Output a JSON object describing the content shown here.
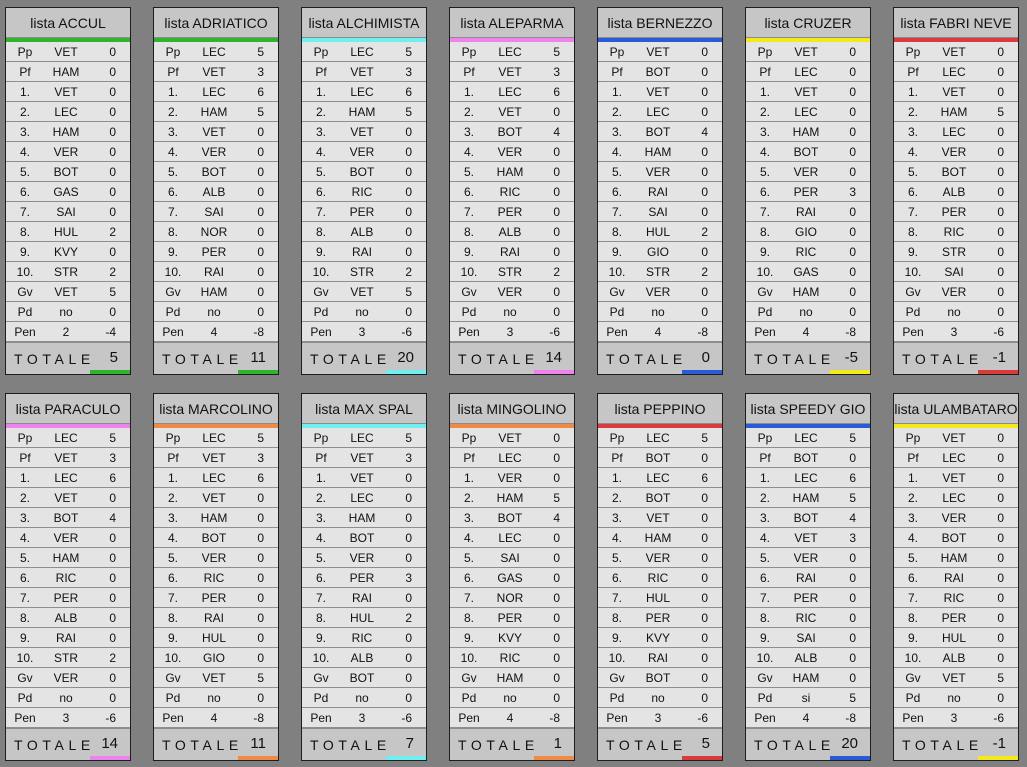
{
  "totale_label": "TOTALE",
  "cards": [
    {
      "title": "lista ACCUL",
      "color": "#2db52d",
      "total": "5",
      "rows": [
        [
          "Pp",
          "VET",
          "0"
        ],
        [
          "Pf",
          "HAM",
          "0"
        ],
        [
          "1.",
          "VET",
          "0"
        ],
        [
          "2.",
          "LEC",
          "0"
        ],
        [
          "3.",
          "HAM",
          "0"
        ],
        [
          "4.",
          "VER",
          "0"
        ],
        [
          "5.",
          "BOT",
          "0"
        ],
        [
          "6.",
          "GAS",
          "0"
        ],
        [
          "7.",
          "SAI",
          "0"
        ],
        [
          "8.",
          "HUL",
          "2"
        ],
        [
          "9.",
          "KVY",
          "0"
        ],
        [
          "10.",
          "STR",
          "2"
        ],
        [
          "Gv",
          "VET",
          "5"
        ],
        [
          "Pd",
          "no",
          "0"
        ],
        [
          "Pen",
          "2",
          "-4"
        ]
      ]
    },
    {
      "title": "lista ADRIATICO",
      "color": "#2db52d",
      "total": "11",
      "rows": [
        [
          "Pp",
          "LEC",
          "5"
        ],
        [
          "Pf",
          "VET",
          "3"
        ],
        [
          "1.",
          "LEC",
          "6"
        ],
        [
          "2.",
          "HAM",
          "5"
        ],
        [
          "3.",
          "VET",
          "0"
        ],
        [
          "4.",
          "VER",
          "0"
        ],
        [
          "5.",
          "BOT",
          "0"
        ],
        [
          "6.",
          "ALB",
          "0"
        ],
        [
          "7.",
          "SAI",
          "0"
        ],
        [
          "8.",
          "NOR",
          "0"
        ],
        [
          "9.",
          "PER",
          "0"
        ],
        [
          "10.",
          "RAI",
          "0"
        ],
        [
          "Gv",
          "HAM",
          "0"
        ],
        [
          "Pd",
          "no",
          "0"
        ],
        [
          "Pen",
          "4",
          "-8"
        ]
      ]
    },
    {
      "title": "lista ALCHIMISTA",
      "color": "#6ff0f0",
      "total": "20",
      "rows": [
        [
          "Pp",
          "LEC",
          "5"
        ],
        [
          "Pf",
          "VET",
          "3"
        ],
        [
          "1.",
          "LEC",
          "6"
        ],
        [
          "2.",
          "HAM",
          "5"
        ],
        [
          "3.",
          "VET",
          "0"
        ],
        [
          "4.",
          "VER",
          "0"
        ],
        [
          "5.",
          "BOT",
          "0"
        ],
        [
          "6.",
          "RIC",
          "0"
        ],
        [
          "7.",
          "PER",
          "0"
        ],
        [
          "8.",
          "ALB",
          "0"
        ],
        [
          "9.",
          "RAI",
          "0"
        ],
        [
          "10.",
          "STR",
          "2"
        ],
        [
          "Gv",
          "VET",
          "5"
        ],
        [
          "Pd",
          "no",
          "0"
        ],
        [
          "Pen",
          "3",
          "-6"
        ]
      ]
    },
    {
      "title": "lista ALEPARMA",
      "color": "#ee82ee",
      "total": "14",
      "rows": [
        [
          "Pp",
          "LEC",
          "5"
        ],
        [
          "Pf",
          "VET",
          "3"
        ],
        [
          "1.",
          "LEC",
          "6"
        ],
        [
          "2.",
          "VET",
          "0"
        ],
        [
          "3.",
          "BOT",
          "4"
        ],
        [
          "4.",
          "VER",
          "0"
        ],
        [
          "5.",
          "HAM",
          "0"
        ],
        [
          "6.",
          "RIC",
          "0"
        ],
        [
          "7.",
          "PER",
          "0"
        ],
        [
          "8.",
          "ALB",
          "0"
        ],
        [
          "9.",
          "RAI",
          "0"
        ],
        [
          "10.",
          "STR",
          "2"
        ],
        [
          "Gv",
          "VER",
          "0"
        ],
        [
          "Pd",
          "no",
          "0"
        ],
        [
          "Pen",
          "3",
          "-6"
        ]
      ]
    },
    {
      "title": "lista BERNEZZO",
      "color": "#2a5bd7",
      "total": "0",
      "rows": [
        [
          "Pp",
          "VET",
          "0"
        ],
        [
          "Pf",
          "BOT",
          "0"
        ],
        [
          "1.",
          "VET",
          "0"
        ],
        [
          "2.",
          "LEC",
          "0"
        ],
        [
          "3.",
          "BOT",
          "4"
        ],
        [
          "4.",
          "HAM",
          "0"
        ],
        [
          "5.",
          "VER",
          "0"
        ],
        [
          "6.",
          "RAI",
          "0"
        ],
        [
          "7.",
          "SAI",
          "0"
        ],
        [
          "8.",
          "HUL",
          "2"
        ],
        [
          "9.",
          "GIO",
          "0"
        ],
        [
          "10.",
          "STR",
          "2"
        ],
        [
          "Gv",
          "VER",
          "0"
        ],
        [
          "Pd",
          "no",
          "0"
        ],
        [
          "Pen",
          "4",
          "-8"
        ]
      ]
    },
    {
      "title": "lista CRUZER",
      "color": "#f2ea1a",
      "total": "-5",
      "rows": [
        [
          "Pp",
          "VET",
          "0"
        ],
        [
          "Pf",
          "LEC",
          "0"
        ],
        [
          "1.",
          "VET",
          "0"
        ],
        [
          "2.",
          "LEC",
          "0"
        ],
        [
          "3.",
          "HAM",
          "0"
        ],
        [
          "4.",
          "BOT",
          "0"
        ],
        [
          "5.",
          "VER",
          "0"
        ],
        [
          "6.",
          "PER",
          "3"
        ],
        [
          "7.",
          "RAI",
          "0"
        ],
        [
          "8.",
          "GIO",
          "0"
        ],
        [
          "9.",
          "RIC",
          "0"
        ],
        [
          "10.",
          "GAS",
          "0"
        ],
        [
          "Gv",
          "HAM",
          "0"
        ],
        [
          "Pd",
          "no",
          "0"
        ],
        [
          "Pen",
          "4",
          "-8"
        ]
      ]
    },
    {
      "title": "lista FABRI NEVE",
      "color": "#d93a3a",
      "total": "-1",
      "rows": [
        [
          "Pp",
          "VET",
          "0"
        ],
        [
          "Pf",
          "LEC",
          "0"
        ],
        [
          "1.",
          "VET",
          "0"
        ],
        [
          "2.",
          "HAM",
          "5"
        ],
        [
          "3.",
          "LEC",
          "0"
        ],
        [
          "4.",
          "VER",
          "0"
        ],
        [
          "5.",
          "BOT",
          "0"
        ],
        [
          "6.",
          "ALB",
          "0"
        ],
        [
          "7.",
          "PER",
          "0"
        ],
        [
          "8.",
          "RIC",
          "0"
        ],
        [
          "9.",
          "STR",
          "0"
        ],
        [
          "10.",
          "SAI",
          "0"
        ],
        [
          "Gv",
          "VER",
          "0"
        ],
        [
          "Pd",
          "no",
          "0"
        ],
        [
          "Pen",
          "3",
          "-6"
        ]
      ]
    },
    {
      "title": "lista PARACULO",
      "color": "#ee82ee",
      "total": "14",
      "rows": [
        [
          "Pp",
          "LEC",
          "5"
        ],
        [
          "Pf",
          "VET",
          "3"
        ],
        [
          "1.",
          "LEC",
          "6"
        ],
        [
          "2.",
          "VET",
          "0"
        ],
        [
          "3.",
          "BOT",
          "4"
        ],
        [
          "4.",
          "VER",
          "0"
        ],
        [
          "5.",
          "HAM",
          "0"
        ],
        [
          "6.",
          "RIC",
          "0"
        ],
        [
          "7.",
          "PER",
          "0"
        ],
        [
          "8.",
          "ALB",
          "0"
        ],
        [
          "9.",
          "RAI",
          "0"
        ],
        [
          "10.",
          "STR",
          "2"
        ],
        [
          "Gv",
          "VER",
          "0"
        ],
        [
          "Pd",
          "no",
          "0"
        ],
        [
          "Pen",
          "3",
          "-6"
        ]
      ]
    },
    {
      "title": "lista MARCOLINO",
      "color": "#f08a45",
      "total": "11",
      "rows": [
        [
          "Pp",
          "LEC",
          "5"
        ],
        [
          "Pf",
          "VET",
          "3"
        ],
        [
          "1.",
          "LEC",
          "6"
        ],
        [
          "2.",
          "VET",
          "0"
        ],
        [
          "3.",
          "HAM",
          "0"
        ],
        [
          "4.",
          "BOT",
          "0"
        ],
        [
          "5.",
          "VER",
          "0"
        ],
        [
          "6.",
          "RIC",
          "0"
        ],
        [
          "7.",
          "PER",
          "0"
        ],
        [
          "8.",
          "RAI",
          "0"
        ],
        [
          "9.",
          "HUL",
          "0"
        ],
        [
          "10.",
          "GIO",
          "0"
        ],
        [
          "Gv",
          "VET",
          "5"
        ],
        [
          "Pd",
          "no",
          "0"
        ],
        [
          "Pen",
          "4",
          "-8"
        ]
      ]
    },
    {
      "title": "lista MAX SPAL",
      "color": "#6ff0f0",
      "total": "7",
      "rows": [
        [
          "Pp",
          "LEC",
          "5"
        ],
        [
          "Pf",
          "VET",
          "3"
        ],
        [
          "1.",
          "VET",
          "0"
        ],
        [
          "2.",
          "LEC",
          "0"
        ],
        [
          "3.",
          "HAM",
          "0"
        ],
        [
          "4.",
          "BOT",
          "0"
        ],
        [
          "5.",
          "VER",
          "0"
        ],
        [
          "6.",
          "PER",
          "3"
        ],
        [
          "7.",
          "RAI",
          "0"
        ],
        [
          "8.",
          "HUL",
          "2"
        ],
        [
          "9.",
          "RIC",
          "0"
        ],
        [
          "10.",
          "ALB",
          "0"
        ],
        [
          "Gv",
          "BOT",
          "0"
        ],
        [
          "Pd",
          "no",
          "0"
        ],
        [
          "Pen",
          "3",
          "-6"
        ]
      ]
    },
    {
      "title": "lista MINGOLINO",
      "color": "#f08a45",
      "total": "1",
      "rows": [
        [
          "Pp",
          "VET",
          "0"
        ],
        [
          "Pf",
          "LEC",
          "0"
        ],
        [
          "1.",
          "VER",
          "0"
        ],
        [
          "2.",
          "HAM",
          "5"
        ],
        [
          "3.",
          "BOT",
          "4"
        ],
        [
          "4.",
          "LEC",
          "0"
        ],
        [
          "5.",
          "SAI",
          "0"
        ],
        [
          "6.",
          "GAS",
          "0"
        ],
        [
          "7.",
          "NOR",
          "0"
        ],
        [
          "8.",
          "PER",
          "0"
        ],
        [
          "9.",
          "KVY",
          "0"
        ],
        [
          "10.",
          "RIC",
          "0"
        ],
        [
          "Gv",
          "HAM",
          "0"
        ],
        [
          "Pd",
          "no",
          "0"
        ],
        [
          "Pen",
          "4",
          "-8"
        ]
      ]
    },
    {
      "title": "lista PEPPINO",
      "color": "#d93a3a",
      "total": "5",
      "rows": [
        [
          "Pp",
          "LEC",
          "5"
        ],
        [
          "Pf",
          "BOT",
          "0"
        ],
        [
          "1.",
          "LEC",
          "6"
        ],
        [
          "2.",
          "BOT",
          "0"
        ],
        [
          "3.",
          "VET",
          "0"
        ],
        [
          "4.",
          "HAM",
          "0"
        ],
        [
          "5.",
          "VER",
          "0"
        ],
        [
          "6.",
          "RIC",
          "0"
        ],
        [
          "7.",
          "HUL",
          "0"
        ],
        [
          "8.",
          "PER",
          "0"
        ],
        [
          "9.",
          "KVY",
          "0"
        ],
        [
          "10.",
          "RAI",
          "0"
        ],
        [
          "Gv",
          "BOT",
          "0"
        ],
        [
          "Pd",
          "no",
          "0"
        ],
        [
          "Pen",
          "3",
          "-6"
        ]
      ]
    },
    {
      "title": "lista SPEEDY GIO",
      "color": "#2a5bd7",
      "total": "20",
      "rows": [
        [
          "Pp",
          "LEC",
          "5"
        ],
        [
          "Pf",
          "BOT",
          "0"
        ],
        [
          "1.",
          "LEC",
          "6"
        ],
        [
          "2.",
          "HAM",
          "5"
        ],
        [
          "3.",
          "BOT",
          "4"
        ],
        [
          "4.",
          "VET",
          "3"
        ],
        [
          "5.",
          "VER",
          "0"
        ],
        [
          "6.",
          "RAI",
          "0"
        ],
        [
          "7.",
          "PER",
          "0"
        ],
        [
          "8.",
          "RIC",
          "0"
        ],
        [
          "9.",
          "SAI",
          "0"
        ],
        [
          "10.",
          "ALB",
          "0"
        ],
        [
          "Gv",
          "HAM",
          "0"
        ],
        [
          "Pd",
          "si",
          "5"
        ],
        [
          "Pen",
          "4",
          "-8"
        ]
      ]
    },
    {
      "title": "lista ULAMBATARO",
      "color": "#f2ea1a",
      "total": "-1",
      "rows": [
        [
          "Pp",
          "VET",
          "0"
        ],
        [
          "Pf",
          "LEC",
          "0"
        ],
        [
          "1.",
          "VET",
          "0"
        ],
        [
          "2.",
          "LEC",
          "0"
        ],
        [
          "3.",
          "VER",
          "0"
        ],
        [
          "4.",
          "BOT",
          "0"
        ],
        [
          "5.",
          "HAM",
          "0"
        ],
        [
          "6.",
          "RAI",
          "0"
        ],
        [
          "7.",
          "RIC",
          "0"
        ],
        [
          "8.",
          "PER",
          "0"
        ],
        [
          "9.",
          "HUL",
          "0"
        ],
        [
          "10.",
          "ALB",
          "0"
        ],
        [
          "Gv",
          "VET",
          "5"
        ],
        [
          "Pd",
          "no",
          "0"
        ],
        [
          "Pen",
          "3",
          "-6"
        ]
      ]
    }
  ]
}
